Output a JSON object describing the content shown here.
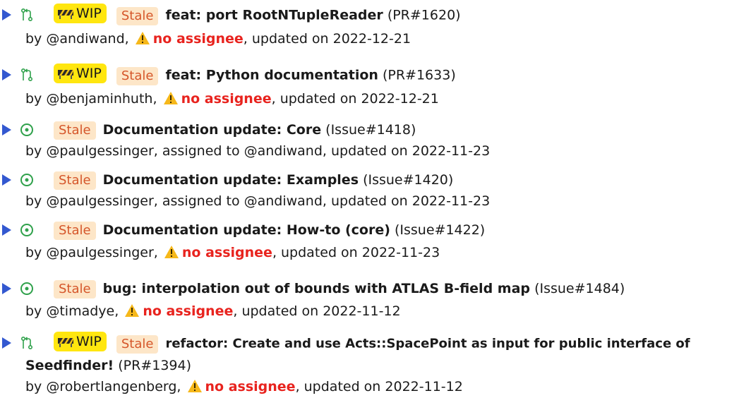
{
  "colors": {
    "accent": "#3358d0",
    "wip": "#ffe60f",
    "stale_bg": "#fde6c8",
    "stale_text": "#d5562a",
    "warning": "#e8231e",
    "open_issue": "#2fa14b"
  },
  "items": [
    {
      "type": "pr",
      "icon": "pull-request-icon",
      "wip": "WIP",
      "stale": "Stale",
      "title": "feat: port RootNTupleReader",
      "ref": "(PR#1620)",
      "by": "by @andiwand,",
      "assignee": "no assignee",
      "updated": ", updated on 2022-12-21"
    },
    {
      "type": "pr",
      "icon": "pull-request-icon",
      "wip": "WIP",
      "stale": "Stale",
      "title": "feat: Python documentation",
      "ref": "(PR#1633)",
      "by": "by @benjaminhuth,",
      "assignee": "no assignee",
      "updated": ", updated on 2022-12-21"
    },
    {
      "type": "issue",
      "icon": "issue-open-icon",
      "stale": "Stale",
      "title": "Documentation update: Core",
      "ref": "(Issue#1418)",
      "meta": "by @paulgessinger, assigned to @andiwand, updated on 2022-11-23"
    },
    {
      "type": "issue",
      "icon": "issue-open-icon",
      "stale": "Stale",
      "title": "Documentation update: Examples",
      "ref": "(Issue#1420)",
      "meta": "by @paulgessinger, assigned to @andiwand, updated on 2022-11-23"
    },
    {
      "type": "issue",
      "icon": "issue-open-icon",
      "stale": "Stale",
      "title": "Documentation update: How-to (core)",
      "ref": "(Issue#1422)",
      "by": "by @paulgessinger,",
      "assignee": "no assignee",
      "updated": ", updated on 2022-11-23"
    },
    {
      "type": "issue",
      "icon": "issue-open-icon",
      "stale": "Stale",
      "title": "bug: interpolation out of bounds with ATLAS B-field map",
      "ref": "(Issue#1484)",
      "by": "by @timadye,",
      "assignee": "no assignee",
      "updated": ", updated on 2022-11-12"
    },
    {
      "type": "pr",
      "icon": "pull-request-icon",
      "wip": "WIP",
      "stale": "Stale",
      "title": "refactor: Create and use Acts::SpacePoint as input for public interface of",
      "title_cont": "Seedfinder!",
      "ref": "(PR#1394)",
      "by": "by @robertlangenberg,",
      "assignee": "no assignee",
      "updated": ", updated on 2022-11-12"
    }
  ]
}
